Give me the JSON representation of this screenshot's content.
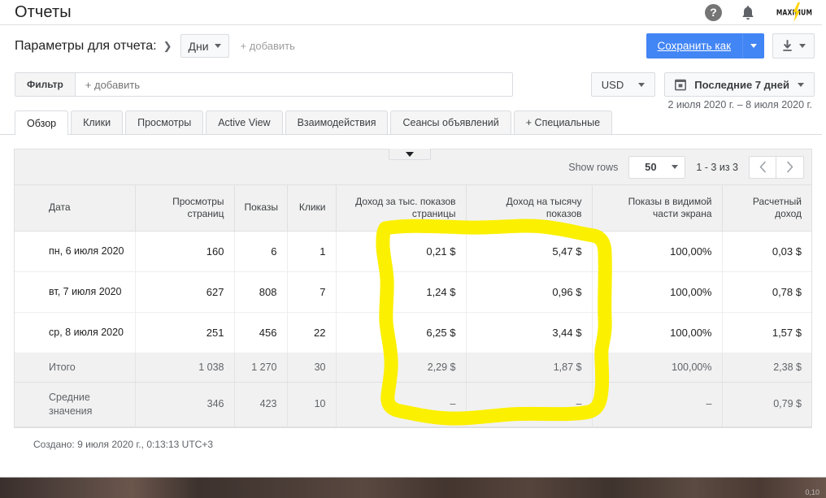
{
  "header": {
    "title": "Отчеты",
    "help_icon": "help-circle-icon",
    "bell_icon": "notifications-bell-icon",
    "brand": "MAXIMUM",
    "brand_bolt_color": "#ffd400"
  },
  "params": {
    "label": "Параметры для отчета:",
    "arrow": "❯",
    "dimension_chip": "Дни",
    "add_label": "+ добавить",
    "save_label": "Сохранить как",
    "download_icon": "download-icon",
    "accent_blue": "#4285f4"
  },
  "filter": {
    "tag_label": "Фильтр",
    "placeholder": "+ добавить",
    "currency": "USD",
    "date_range_label": "Последние 7 дней",
    "calendar_icon": "calendar-icon",
    "date_range_text": "2 июля 2020 г. – 8 июля 2020 г."
  },
  "tabs": [
    {
      "label": "Обзор",
      "active": true
    },
    {
      "label": "Клики",
      "active": false
    },
    {
      "label": "Просмотры",
      "active": false
    },
    {
      "label": "Active View",
      "active": false
    },
    {
      "label": "Взаимодействия",
      "active": false
    },
    {
      "label": "Сеансы объявлений",
      "active": false
    },
    {
      "label": "+ Специальные",
      "active": false
    }
  ],
  "table_toolbar": {
    "show_rows_label": "Show rows",
    "rows_value": "50",
    "page_count": "1 - 3 из 3",
    "prev_icon": "chevron-left-icon",
    "next_icon": "chevron-right-icon"
  },
  "table": {
    "columns": [
      "Дата",
      "Просмотры страниц",
      "Показы",
      "Клики",
      "Доход за тыс. показов страницы",
      "Доход на тысячу показов",
      "Показы в видимой части экрана",
      "Расчетный доход"
    ],
    "rows": [
      {
        "date": "пн, 6 июля 2020",
        "page_views": "160",
        "impressions": "6",
        "clicks": "1",
        "page_rpm": "0,21 $",
        "impression_rpm": "5,47 $",
        "viewable": "100,00%",
        "est_earnings": "0,03 $"
      },
      {
        "date": "вт, 7 июля 2020",
        "page_views": "627",
        "impressions": "808",
        "clicks": "7",
        "page_rpm": "1,24 $",
        "impression_rpm": "0,96 $",
        "viewable": "100,00%",
        "est_earnings": "0,78 $"
      },
      {
        "date": "ср, 8 июля 2020",
        "page_views": "251",
        "impressions": "456",
        "clicks": "22",
        "page_rpm": "6,25 $",
        "impression_rpm": "3,44 $",
        "viewable": "100,00%",
        "est_earnings": "1,57 $"
      }
    ],
    "total_row": {
      "date": "Итого",
      "page_views": "1 038",
      "impressions": "1 270",
      "clicks": "30",
      "page_rpm": "2,29 $",
      "impression_rpm": "1,87 $",
      "viewable": "100,00%",
      "est_earnings": "2,38 $"
    },
    "average_row": {
      "date": "Средние значения",
      "page_views": "346",
      "impressions": "423",
      "clicks": "10",
      "page_rpm": "–",
      "impression_rpm": "–",
      "viewable": "–",
      "est_earnings": "0,79 $"
    }
  },
  "footer": {
    "created": "Создано: 9 июля 2020 г., 0:13:13 UTC+3"
  },
  "annotation": {
    "type": "hand-drawn-highlight",
    "color": "#fbf000",
    "target": "Доход за тыс. показов страницы / Доход на тысячу показов"
  },
  "bottom_strip": {
    "number": "0,10"
  },
  "collapse": {
    "icon": "chevron-down-icon"
  }
}
